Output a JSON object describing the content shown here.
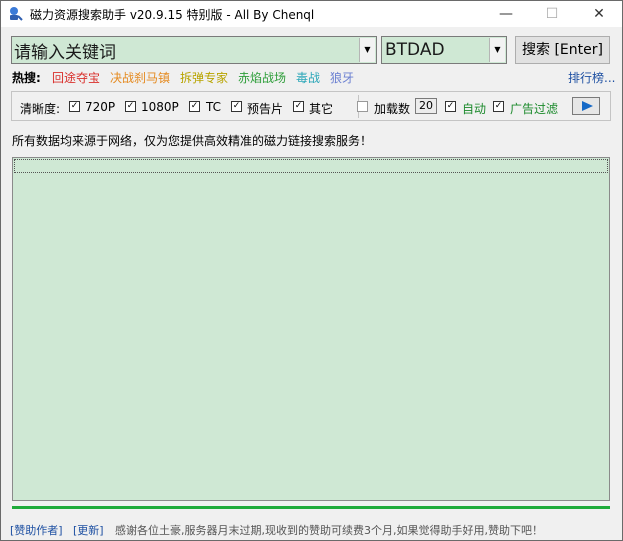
{
  "window": {
    "title": "磁力资源搜索助手 v20.9.15 特别版 - All By Chenql",
    "minimize": "—",
    "maximize": "☐",
    "close": "✕"
  },
  "search": {
    "value": "请输入关键词",
    "site": "BTDAD",
    "button": "搜索 [Enter]"
  },
  "hot": {
    "label": "热搜:",
    "items": [
      {
        "text": "回途夺宝",
        "color": "#d9302c"
      },
      {
        "text": "决战刹马镇",
        "color": "#e58a1f"
      },
      {
        "text": "拆弹专家",
        "color": "#b8a400"
      },
      {
        "text": "赤焰战场",
        "color": "#2e9e3a"
      },
      {
        "text": "毒战",
        "color": "#2aa6b8"
      },
      {
        "text": "狼牙",
        "color": "#6a7fd1"
      }
    ],
    "rank_link": "排行榜..."
  },
  "filters": {
    "clarity_label": "清晰度:",
    "options": [
      {
        "label": "720P",
        "checked": true
      },
      {
        "label": "1080P",
        "checked": true
      },
      {
        "label": "TC",
        "checked": true
      },
      {
        "label": "预告片",
        "checked": true
      },
      {
        "label": "其它",
        "checked": true
      }
    ],
    "load_count_label": "加载数",
    "load_count_checked": false,
    "load_count_value": "20",
    "auto_label": "自动",
    "auto_checked": true,
    "ad_filter_label": "广告过滤",
    "ad_filter_checked": true
  },
  "notice": "所有数据均来源于网络，仅为您提供高效精准的磁力链接搜索服务！",
  "status": {
    "donate_link": "[赞助作者]",
    "update_link": "[更新]",
    "message": "感谢各位土豪,服务器月末过期,现收到的赞助可续费3个月,如果觉得助手好用,赞助下吧！"
  },
  "colors": {
    "accent_green": "#cfe8d4",
    "progress": "#1faa3a",
    "link_blue": "#1e50a2"
  }
}
